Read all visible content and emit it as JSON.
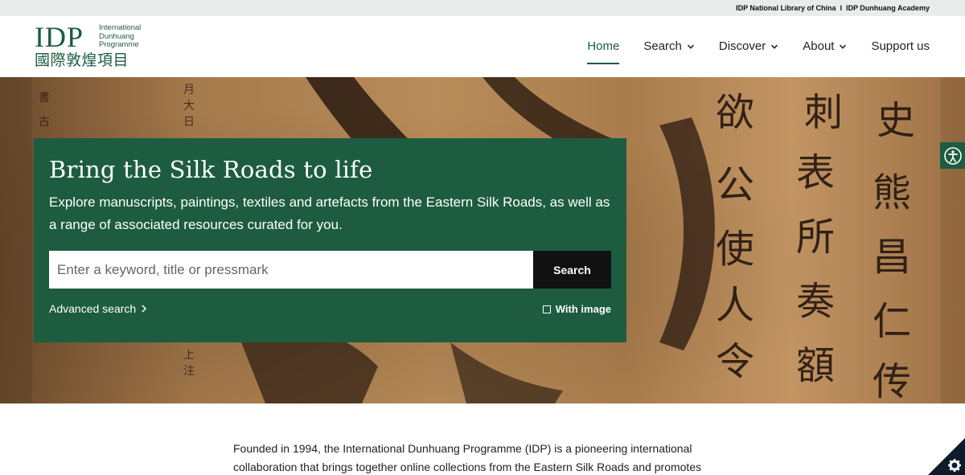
{
  "topbar": {
    "link1": "IDP National Library of China",
    "separator": "I",
    "link2": "IDP Dunhuang Academy"
  },
  "logo": {
    "abbr": "IDP",
    "en_line1": "International",
    "en_line2": "Dunhuang",
    "en_line3": "Programme",
    "zh": "國際敦煌項目"
  },
  "nav": {
    "home": "Home",
    "search": "Search",
    "discover": "Discover",
    "about": "About",
    "support": "Support us"
  },
  "hero": {
    "title": "Bring the Silk Roads to life",
    "subtitle": "Explore manuscripts, paintings, textiles and artefacts from the Eastern Silk Roads, as well as a range of associated resources curated for you.",
    "search_placeholder": "Enter a keyword, title or pressmark",
    "search_button": "Search",
    "advanced_search": "Advanced search",
    "with_image": "With image"
  },
  "intro": {
    "text": "Founded in 1994, the International Dunhuang Programme (IDP) is a pioneering international collaboration that brings together online collections from the Eastern Silk Roads and promotes the"
  },
  "icons": {
    "accessibility": "accessibility-icon",
    "cookie": "gear-icon",
    "chevron": "chevron-down-icon",
    "advanced": "chevron-right-icon"
  },
  "colors": {
    "brand_green": "#1d5c40",
    "button_black": "#111111",
    "topbar_bg": "#e8ecea"
  }
}
